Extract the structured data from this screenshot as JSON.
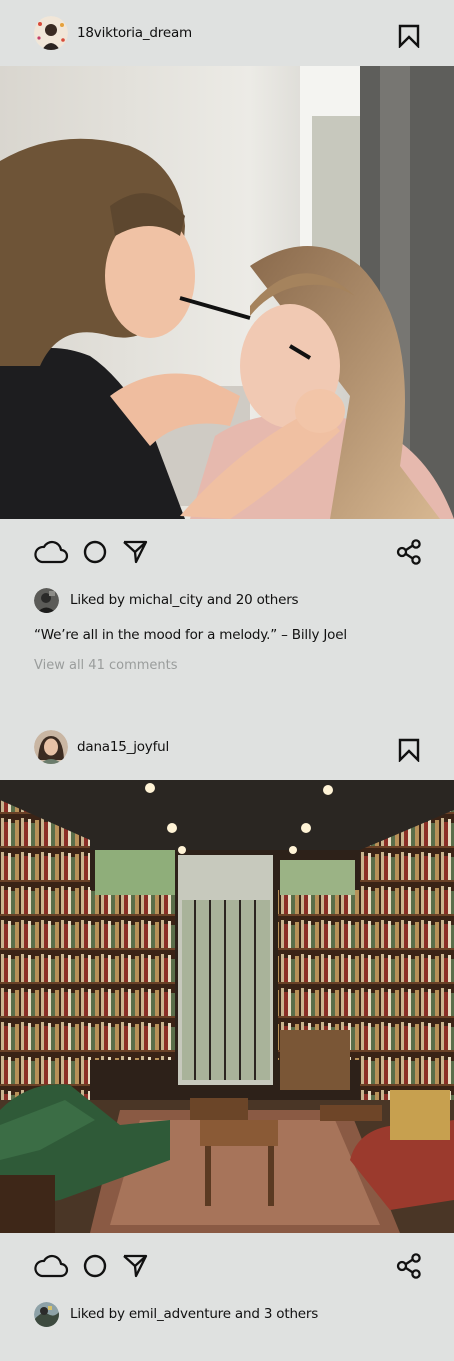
{
  "posts": [
    {
      "username": "18viktoria_dream",
      "likes_text": "Liked by michal_city and 20 others",
      "caption": "“We’re all in the mood for a melody.” – Billy Joel",
      "comments_link": "View all 41 comments"
    },
    {
      "username": "dana15_joyful",
      "likes_text": "Liked by emil_adventure and 3 others"
    }
  ],
  "icons": {
    "bookmark": "bookmark-icon",
    "like": "cloud-icon",
    "comment": "circle-icon",
    "send": "send-icon",
    "share": "share-icon"
  }
}
